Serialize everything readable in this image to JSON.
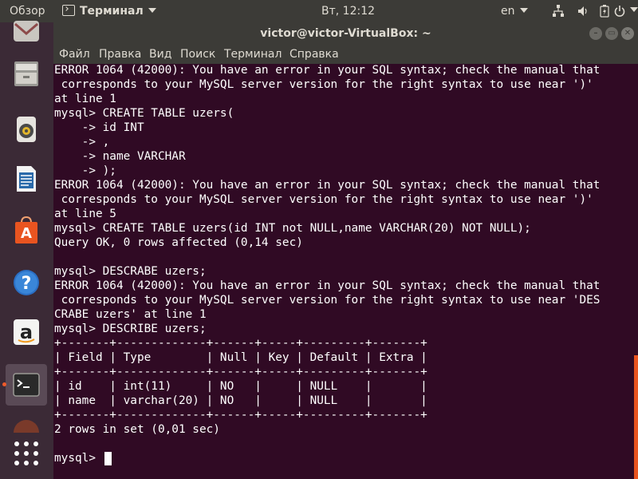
{
  "top_panel": {
    "activities": "Обзор",
    "app_menu": "Терминал",
    "clock": "Вт, 12:12",
    "lang": "en"
  },
  "dock": {
    "items": [
      "email-client",
      "files",
      "rhythmbox",
      "libreoffice-writer",
      "ubuntu-software",
      "help",
      "amazon",
      "terminal",
      "show-applications"
    ]
  },
  "window": {
    "title": "victor@victor-VirtualBox: ~",
    "menu": [
      "Файл",
      "Правка",
      "Вид",
      "Поиск",
      "Терминал",
      "Справка"
    ]
  },
  "terminal": {
    "lines": [
      "ERROR 1064 (42000): You have an error in your SQL syntax; check the manual that",
      " corresponds to your MySQL server version for the right syntax to use near ')'",
      "at line 1",
      "mysql> CREATE TABLE uzers(",
      "    -> id INT",
      "    -> ,",
      "    -> name VARCHAR",
      "    -> );",
      "ERROR 1064 (42000): You have an error in your SQL syntax; check the manual that",
      " corresponds to your MySQL server version for the right syntax to use near ')'",
      "at line 5",
      "mysql> CREATE TABLE uzers(id INT not NULL,name VARCHAR(20) NOT NULL);",
      "Query OK, 0 rows affected (0,14 sec)",
      "",
      "mysql> DESCRABE uzers;",
      "ERROR 1064 (42000): You have an error in your SQL syntax; check the manual that",
      " corresponds to your MySQL server version for the right syntax to use near 'DES",
      "CRABE uzers' at line 1",
      "mysql> DESCRIBE uzers;",
      "+-------+-------------+------+-----+---------+-------+",
      "| Field | Type        | Null | Key | Default | Extra |",
      "+-------+-------------+------+-----+---------+-------+",
      "| id    | int(11)     | NO   |     | NULL    |       |",
      "| name  | varchar(20) | NO   |     | NULL    |       |",
      "+-------+-------------+------+-----+---------+-------+",
      "2 rows in set (0,01 sec)",
      "",
      "mysql> "
    ]
  },
  "colors": {
    "terminal_bg": "#300a24",
    "panel_bg": "#3c3b37",
    "accent": "#e95420"
  }
}
